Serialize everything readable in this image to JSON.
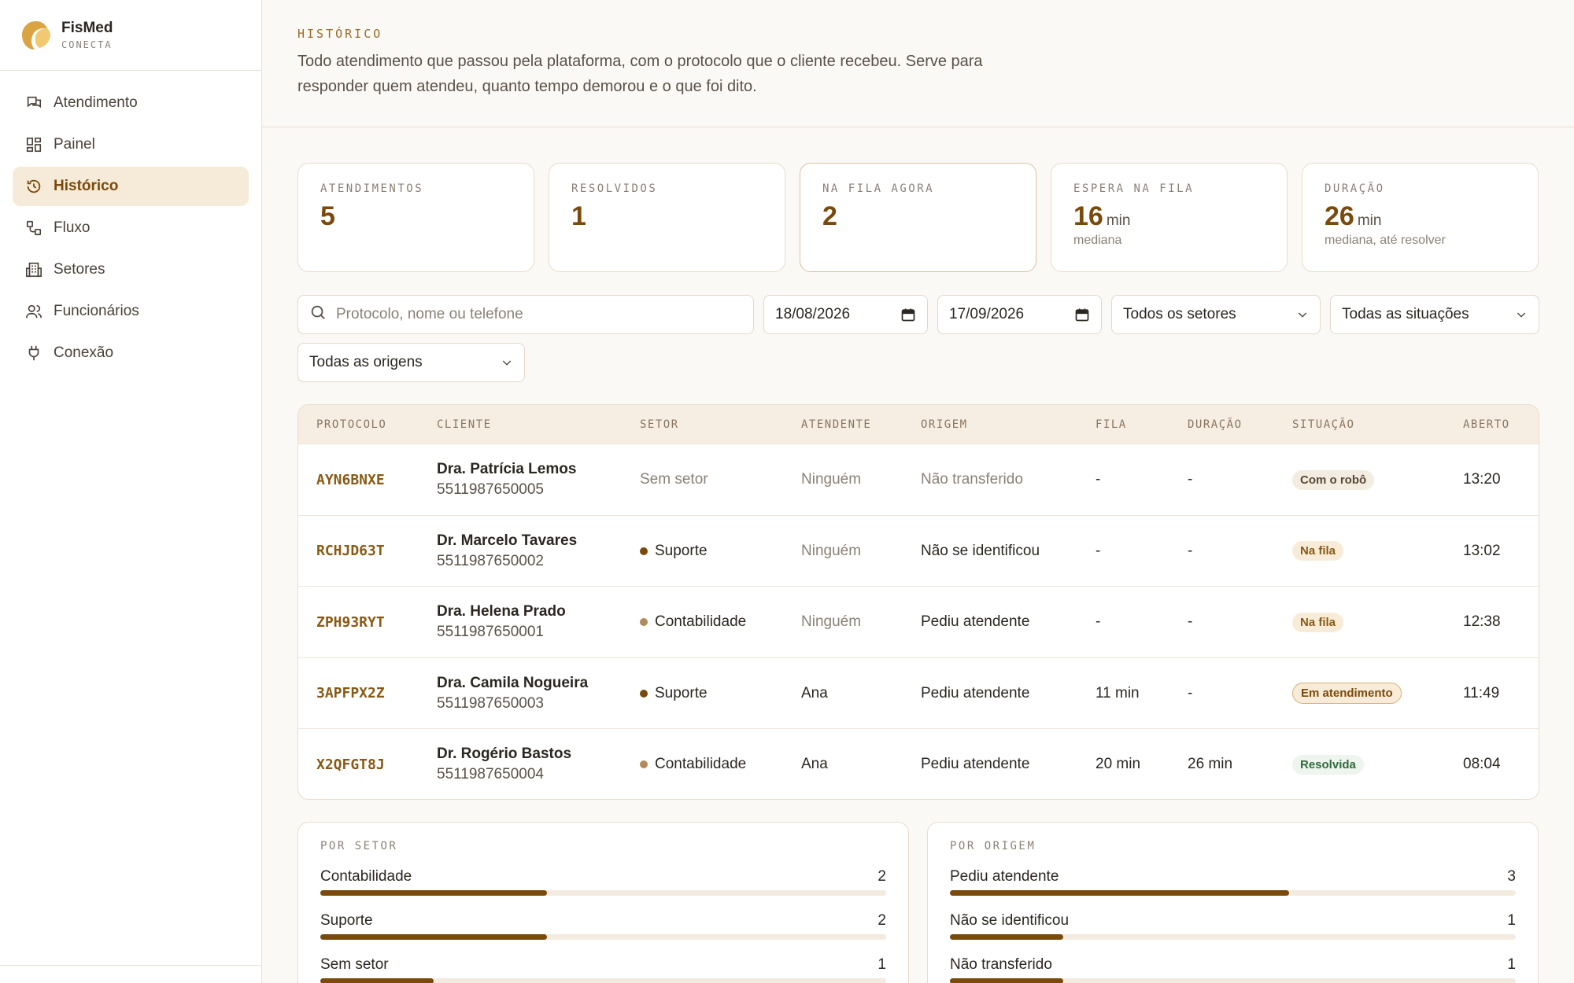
{
  "brand": {
    "name": "FisMed",
    "sub": "CONECTA"
  },
  "sidebar": {
    "items": [
      {
        "label": "Atendimento",
        "icon": "chat-icon",
        "active": false
      },
      {
        "label": "Painel",
        "icon": "dashboard-icon",
        "active": false
      },
      {
        "label": "Histórico",
        "icon": "history-icon",
        "active": true
      },
      {
        "label": "Fluxo",
        "icon": "flow-icon",
        "active": false
      },
      {
        "label": "Setores",
        "icon": "building-icon",
        "active": false
      },
      {
        "label": "Funcionários",
        "icon": "users-icon",
        "active": false
      },
      {
        "label": "Conexão",
        "icon": "plug-icon",
        "active": false
      }
    ]
  },
  "header": {
    "eyebrow": "HISTÓRICO",
    "description": "Todo atendimento que passou pela plataforma, com o protocolo que o cliente recebeu. Serve para responder quem atendeu, quanto tempo demorou e o que foi dito."
  },
  "cards": [
    {
      "label": "ATENDIMENTOS",
      "value": "5",
      "unit": "",
      "sub": ""
    },
    {
      "label": "RESOLVIDOS",
      "value": "1",
      "unit": "",
      "sub": ""
    },
    {
      "label": "NA FILA AGORA",
      "value": "2",
      "unit": "",
      "sub": ""
    },
    {
      "label": "ESPERA NA FILA",
      "value": "16",
      "unit": "min",
      "sub": "mediana"
    },
    {
      "label": "DURAÇÃO",
      "value": "26",
      "unit": "min",
      "sub": "mediana, até resolver"
    }
  ],
  "filters": {
    "search_placeholder": "Protocolo, nome ou telefone",
    "date_from": "18/08/2026",
    "date_to": "17/09/2026",
    "sector": "Todos os setores",
    "status": "Todas as situações",
    "origin": "Todas as origens"
  },
  "table": {
    "headers": [
      "PROTOCOLO",
      "CLIENTE",
      "SETOR",
      "ATENDENTE",
      "ORIGEM",
      "FILA",
      "DURAÇÃO",
      "SITUAÇÃO",
      "ABERTO"
    ],
    "rows": [
      {
        "protocol": "AYN6BNXE",
        "name": "Dra. Patrícia Lemos",
        "phone": "5511987650005",
        "sector": "Sem setor",
        "sector_dot": "",
        "agent": "Ninguém",
        "agent_muted": true,
        "origin": "Não transferido",
        "origin_muted": true,
        "queue": "-",
        "duration": "-",
        "status": "Com o robô",
        "status_style": "robot",
        "opened": "13:20"
      },
      {
        "protocol": "RCHJD63T",
        "name": "Dr. Marcelo Tavares",
        "phone": "5511987650002",
        "sector": "Suporte",
        "sector_dot": "#7a4a0c",
        "agent": "Ninguém",
        "agent_muted": true,
        "origin": "Não se identificou",
        "origin_muted": false,
        "queue": "-",
        "duration": "-",
        "status": "Na fila",
        "status_style": "queue",
        "opened": "13:02"
      },
      {
        "protocol": "ZPH93RYT",
        "name": "Dra. Helena Prado",
        "phone": "5511987650001",
        "sector": "Contabilidade",
        "sector_dot": "#b38a5a",
        "agent": "Ninguém",
        "agent_muted": true,
        "origin": "Pediu atendente",
        "origin_muted": false,
        "queue": "-",
        "duration": "-",
        "status": "Na fila",
        "status_style": "queue",
        "opened": "12:38"
      },
      {
        "protocol": "3APFPX2Z",
        "name": "Dra. Camila Nogueira",
        "phone": "5511987650003",
        "sector": "Suporte",
        "sector_dot": "#7a4a0c",
        "agent": "Ana",
        "agent_muted": false,
        "origin": "Pediu atendente",
        "origin_muted": false,
        "queue": "11 min",
        "duration": "-",
        "status": "Em atendimento",
        "status_style": "active",
        "opened": "11:49"
      },
      {
        "protocol": "X2QFGT8J",
        "name": "Dr. Rogério Bastos",
        "phone": "5511987650004",
        "sector": "Contabilidade",
        "sector_dot": "#b38a5a",
        "agent": "Ana",
        "agent_muted": false,
        "origin": "Pediu atendente",
        "origin_muted": false,
        "queue": "20 min",
        "duration": "26 min",
        "status": "Resolvida",
        "status_style": "resolved",
        "opened": "08:04"
      }
    ]
  },
  "by_sector": {
    "title": "POR SETOR",
    "rows": [
      {
        "name": "Contabilidade",
        "count": "2",
        "fraction": 0.4
      },
      {
        "name": "Suporte",
        "count": "2",
        "fraction": 0.4
      },
      {
        "name": "Sem setor",
        "count": "1",
        "fraction": 0.2
      }
    ]
  },
  "by_origin": {
    "title": "POR ORIGEM",
    "rows": [
      {
        "name": "Pediu atendente",
        "count": "3",
        "fraction": 0.6
      },
      {
        "name": "Não se identificou",
        "count": "1",
        "fraction": 0.2
      },
      {
        "name": "Não transferido",
        "count": "1",
        "fraction": 0.2
      }
    ]
  },
  "colors": {
    "accent": "#7a4a0c",
    "accent_bg": "#f6ead8",
    "resolved_green": "#2f6b3c"
  }
}
